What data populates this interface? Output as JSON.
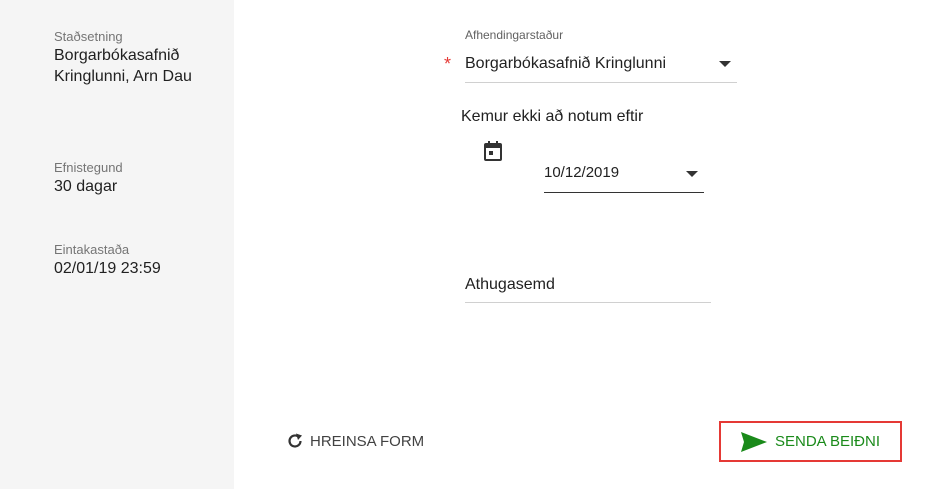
{
  "sidebar": {
    "location_label": "Staðsetning",
    "location_value": "Borgarbókasafnið Kringlunni, Arn Dau",
    "material_type_label": "Efnistegund",
    "material_type_value": "30 dagar",
    "copy_status_label": "Eintakastaða",
    "copy_status_value": "02/01/19 23:59"
  },
  "form": {
    "pickup_label": "Afhendingarstaður",
    "pickup_value": "Borgarbókasafnið Kringlunni",
    "required_marker": "*",
    "not_needed_after_label": "Kemur ekki að notum eftir",
    "date_value": "10/12/2019",
    "comment_label": "Athugasemd"
  },
  "actions": {
    "reset_label": "HREINSA FORM",
    "send_label": "SENDA BEIÐNI"
  },
  "colors": {
    "required": "#e53935",
    "send": "#1a8a1a",
    "highlight_border": "#e53935"
  },
  "icons": {
    "calendar": "calendar-icon",
    "reset": "refresh-icon",
    "send": "send-icon"
  }
}
